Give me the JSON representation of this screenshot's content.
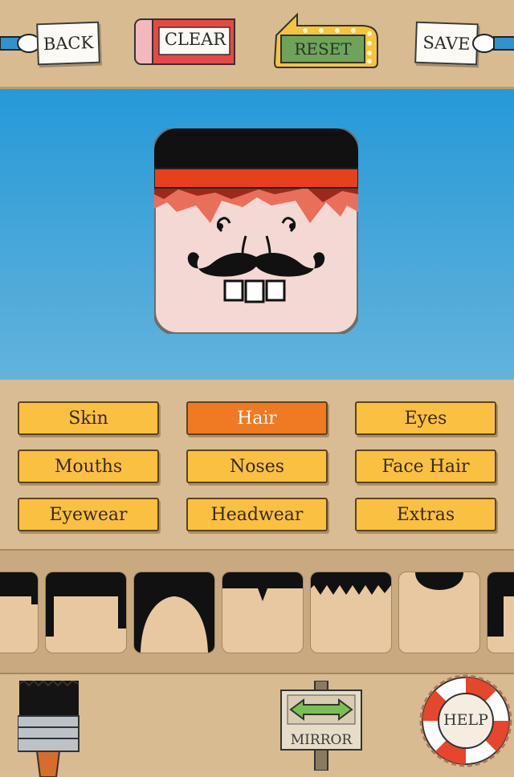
{
  "toolbar": {
    "back_label": "BACK",
    "clear_label": "CLEAR",
    "reset_label": "RESET",
    "save_label": "SAVE"
  },
  "categories": [
    {
      "label": "Skin",
      "active": false
    },
    {
      "label": "Hair",
      "active": true
    },
    {
      "label": "Eyes",
      "active": false
    },
    {
      "label": "Mouths",
      "active": false
    },
    {
      "label": "Noses",
      "active": false
    },
    {
      "label": "Face Hair",
      "active": false
    },
    {
      "label": "Eyewear",
      "active": false
    },
    {
      "label": "Headwear",
      "active": false
    },
    {
      "label": "Extras",
      "active": false
    }
  ],
  "bottom": {
    "mirror_label": "MIRROR",
    "help_label": "HELP"
  },
  "colors": {
    "sky_top": "#2699d7",
    "button_yellow": "#f9c042",
    "button_active": "#f07a24",
    "headband_red": "#e8401c",
    "skin": "#f3d8d3",
    "hair_swatch_skin": "#e7c8a0"
  }
}
